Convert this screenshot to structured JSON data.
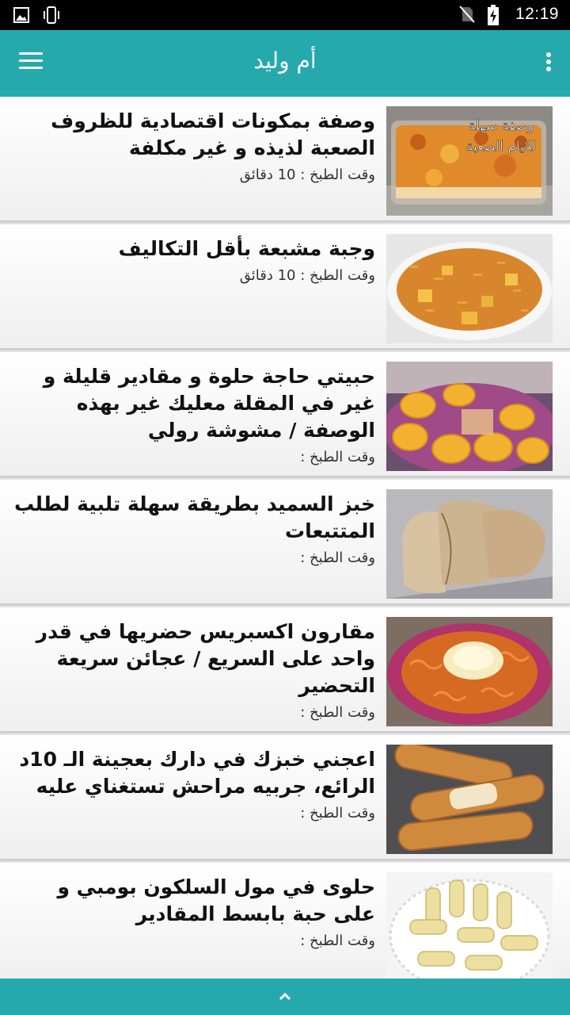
{
  "status_bar": {
    "time": "12:19",
    "left_icons": [
      "image-icon",
      "vibrate-icon"
    ],
    "right_icons": [
      "no-sim-icon",
      "battery-charging-icon"
    ]
  },
  "app_bar": {
    "title": "أم وليد",
    "menu_icon": "hamburger-menu-icon",
    "overflow_icon": "more-vertical-icon",
    "color": "#26a9ad"
  },
  "recipes": [
    {
      "title": "وصفة بمكونات اقتصادية للظروف الصعبة لذيذه و غير مكلفة",
      "cook_time": "وقت الطبخ : 10 دقائق",
      "image_caption": [
        "وصفة سهلة",
        "للايام الصعبة"
      ]
    },
    {
      "title": "وجبة مشبعة بأقل التكاليف",
      "cook_time": "وقت الطبخ : 10 دقائق"
    },
    {
      "title": "حبيتي حاجة حلوة و مقادير قليلة و غير في المقلة معليك غير بهذه الوصفة / مشوشة رولي",
      "cook_time": "وقت الطبخ :"
    },
    {
      "title": "خبز السميد بطريقة سهلة تلبية لطلب المتتبعات",
      "cook_time": "وقت الطبخ :"
    },
    {
      "title": "مقارون اكسبريس حضريها في قدر واحد على السريع / عجائن سريعة التحضير",
      "cook_time": "وقت الطبخ :"
    },
    {
      "title": "اعجني خبزك في دارك بعجينة الـ 10د الرائع، جربيه مراحش تستغناي عليه",
      "cook_time": "وقت الطبخ :"
    },
    {
      "title": "حلوى في مول السلكون بومبي و على حبة بابسط المقادير",
      "cook_time": "وقت الطبخ :"
    }
  ],
  "bottom_bar": {
    "icon": "chevron-up-icon"
  }
}
